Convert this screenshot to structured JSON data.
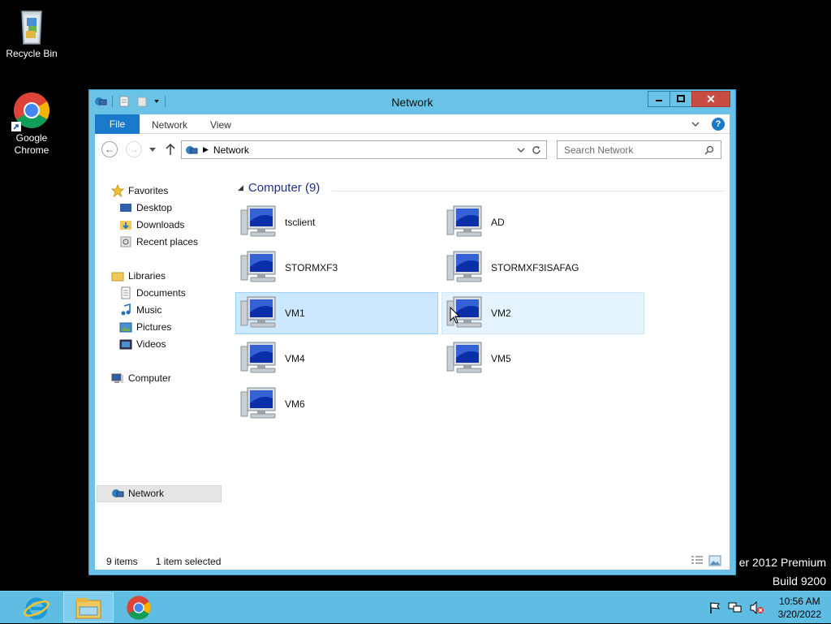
{
  "desktop": {
    "icons": [
      {
        "label": "Recycle Bin"
      },
      {
        "label": "Google Chrome"
      }
    ],
    "watermark_line1": "er 2012 Premium",
    "watermark_line2": "Build 9200"
  },
  "window": {
    "title": "Network",
    "ribbon": {
      "file_tab": "File",
      "tabs": [
        "Network",
        "View"
      ]
    },
    "address": {
      "path": "Network",
      "search_placeholder": "Search Network"
    },
    "nav_pane": {
      "favorites": "Favorites",
      "favorites_items": [
        "Desktop",
        "Downloads",
        "Recent places"
      ],
      "libraries": "Libraries",
      "libraries_items": [
        "Documents",
        "Music",
        "Pictures",
        "Videos"
      ],
      "computer": "Computer",
      "network": "Network"
    },
    "content": {
      "group_header": "Computer (9)",
      "items": [
        "tsclient",
        "AD",
        "STORMXF3",
        "STORMXF3ISAFAG",
        "VM1",
        "VM2",
        "VM4",
        "VM5",
        "VM6"
      ],
      "selected_item": "VM1",
      "hovered_item": "VM2"
    },
    "status": {
      "count": "9 items",
      "selection": "1 item selected"
    }
  },
  "taskbar": {
    "time": "10:56 AM",
    "date": "3/20/2022"
  },
  "colors": {
    "window_frame": "#6ac3e7",
    "ribbon_file_tab": "#1979ca",
    "taskbar": "#5fbde3",
    "selection": "#cce8ff"
  }
}
